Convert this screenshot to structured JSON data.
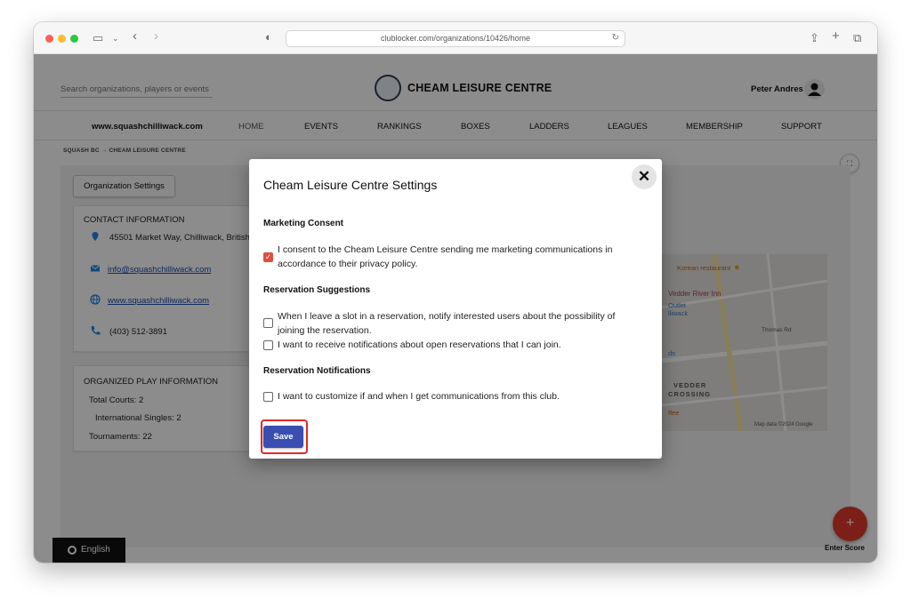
{
  "browser": {
    "url": "clublocker.com/organizations/10426/home"
  },
  "header": {
    "search_placeholder": "Search organizations, players or events",
    "club_name": "CHEAM LEISURE CENTRE",
    "user_name": "Peter Andres"
  },
  "nav": {
    "site_link": "www.squashchilliwack.com",
    "items": [
      "HOME",
      "EVENTS",
      "RANKINGS",
      "BOXES",
      "LADDERS",
      "LEAGUES",
      "MEMBERSHIP",
      "SUPPORT"
    ]
  },
  "breadcrumb": "SQUASH BC → CHEAM LEISURE CENTRE",
  "org_settings_button": "Organization Settings",
  "contact": {
    "title": "CONTACT INFORMATION",
    "address": "45501 Market Way, Chilliwack, British",
    "email": "info@squashchilliwack.com",
    "website": "www.squashchilliwack.com",
    "phone": "(403) 512-3891"
  },
  "organized_play": {
    "title": "ORGANIZED PLAY INFORMATION",
    "total_courts": "Total Courts: 2",
    "international_singles": "International Singles: 2",
    "tournaments": "Tournaments: 22"
  },
  "map": {
    "labels": [
      "Korean restaurant",
      "Vedder River Inn",
      "Outlet",
      "lliwack",
      "Thomas Rd",
      "ds",
      "VEDDER",
      "CROSSING",
      "ffee"
    ],
    "attribution": "Map data ©2024 Google"
  },
  "language_button": "English",
  "enter_score": {
    "icon": "+",
    "label": "Enter Score"
  },
  "modal": {
    "title": "Cheam Leisure Centre Settings",
    "close": "✕",
    "sections": [
      {
        "title": "Marketing Consent",
        "options": [
          {
            "line1": "I consent to the Cheam Leisure Centre sending me marketing communications in",
            "line2": "accordance to their privacy policy.",
            "checked": true
          }
        ]
      },
      {
        "title": "Reservation Suggestions",
        "options": [
          {
            "line1": "When I leave a slot in a reservation, notify interested users about the possibility of",
            "line2": "joining the reservation.",
            "checked": false
          },
          {
            "line1": "I want to receive notifications about open reservations that I can join.",
            "checked": false
          }
        ]
      },
      {
        "title": "Reservation Notifications",
        "options": [
          {
            "line1": "I want to customize if and when I get communications from this club.",
            "checked": false
          }
        ]
      }
    ],
    "save_label": "Save"
  },
  "colors": {
    "primary_button": "#3a4db1",
    "checkbox_checked": "#e24c3f",
    "highlight": "#e02a2a",
    "fab": "#e23a2c"
  }
}
